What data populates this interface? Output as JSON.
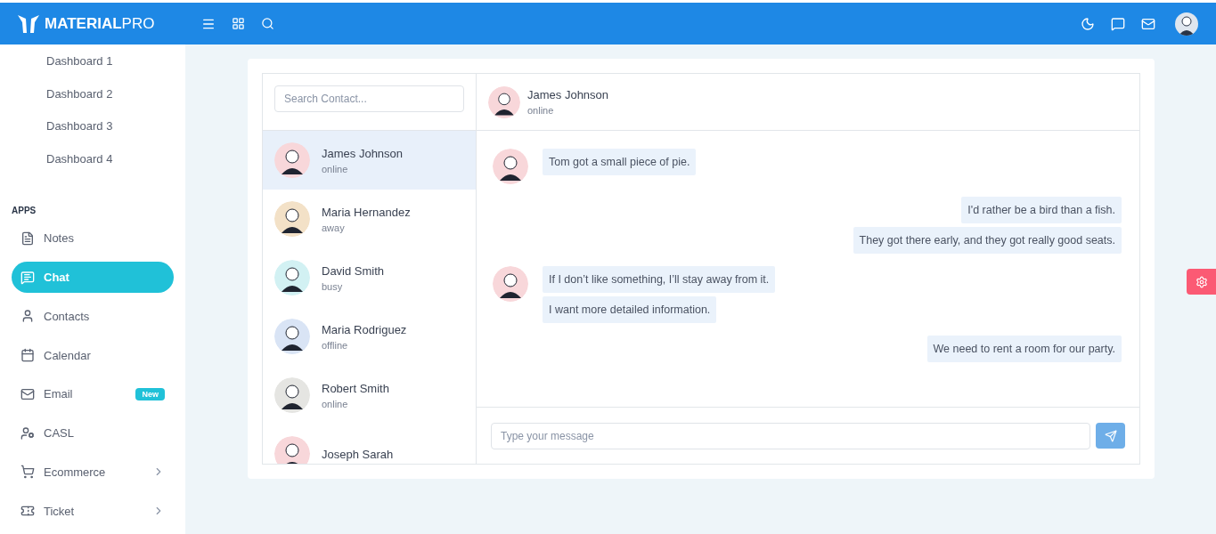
{
  "header": {
    "logo": "**MATERIAL**PRO"
  },
  "sidebar": {
    "dashboards": [
      {
        "label": "Dashboard 1"
      },
      {
        "label": "Dashboard 2"
      },
      {
        "label": "Dashboard 3"
      },
      {
        "label": "Dashboard 4"
      }
    ],
    "section": "APPS",
    "items": [
      {
        "label": "Notes",
        "selected": false,
        "submenu": false
      },
      {
        "label": "Chat",
        "selected": true,
        "submenu": false
      },
      {
        "label": "Contacts",
        "selected": false,
        "submenu": false
      },
      {
        "label": "Calendar",
        "selected": false,
        "submenu": false
      },
      {
        "label": "Email",
        "selected": false,
        "submenu": false,
        "badge": "New"
      },
      {
        "label": "CASL",
        "selected": false,
        "submenu": false
      },
      {
        "label": "Ecommerce",
        "selected": false,
        "submenu": true
      },
      {
        "label": "Ticket",
        "selected": false,
        "submenu": true
      }
    ]
  },
  "contacts": {
    "search": {
      "placeholder": "Search Contact..."
    },
    "items": [
      {
        "name": "James Johnson",
        "status": "online",
        "selected": true,
        "color": "#f8d7da"
      },
      {
        "name": "Maria Hernandez",
        "status": "away",
        "selected": false,
        "color": "#f3e1c7"
      },
      {
        "name": "David Smith",
        "status": "busy",
        "selected": false,
        "color": "#d2f1f3"
      },
      {
        "name": "Maria Rodriguez",
        "status": "offline",
        "selected": false,
        "color": "#d9e4f5"
      },
      {
        "name": "Robert Smith",
        "status": "online",
        "selected": false,
        "color": "#e5e5e2"
      },
      {
        "name": "Joseph Sarah",
        "selected": false,
        "color": "#f8d7da"
      }
    ]
  },
  "chat": {
    "header": {
      "name": "James Johnson",
      "status": "online"
    },
    "groups": [
      {
        "kind": "incoming",
        "messages": [
          "Tom got a small piece of pie."
        ]
      },
      {
        "kind": "outgoing",
        "messages": [
          "I'd rather be a bird than a fish.",
          "They got there early, and they got really good seats."
        ]
      },
      {
        "kind": "incoming",
        "messages": [
          "If I don’t like something, I’ll stay away from it.",
          "I want more detailed information."
        ]
      },
      {
        "kind": "outgoing",
        "messages": [
          "We need to rent a room for our party."
        ]
      }
    ],
    "composer": {
      "placeholder": "Type your message"
    }
  }
}
